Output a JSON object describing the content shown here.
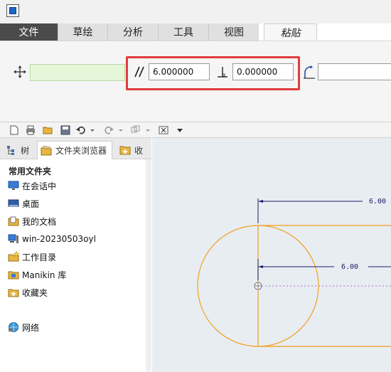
{
  "tabs": [
    {
      "label": "文件"
    },
    {
      "label": "草绘"
    },
    {
      "label": "分析"
    },
    {
      "label": "工具"
    },
    {
      "label": "视图"
    },
    {
      "label": "粘贴"
    }
  ],
  "dashboard": {
    "parallel_value": "6.000000",
    "perpendicular_value": "0.000000",
    "angle_value": ""
  },
  "navigator": {
    "tabs": [
      {
        "label": "树"
      },
      {
        "label": "文件夹浏览器"
      },
      {
        "label": "收"
      }
    ],
    "section_title": "常用文件夹",
    "items": [
      {
        "label": "在会话中",
        "icon": "monitor-icon"
      },
      {
        "label": "桌面",
        "icon": "desktop-icon"
      },
      {
        "label": "我的文档",
        "icon": "documents-icon"
      },
      {
        "label": "win-20230503oyl",
        "icon": "computer-icon"
      },
      {
        "label": "工作目录",
        "icon": "working-folder-icon"
      },
      {
        "label": "Manikin 库",
        "icon": "library-icon"
      },
      {
        "label": "收藏夹",
        "icon": "favorites-icon"
      },
      {
        "label": "网络",
        "icon": "network-icon"
      }
    ]
  },
  "sketch": {
    "dimension_top": "6.00",
    "dimension_center": "6.00",
    "sketch_color": "#f0a020",
    "dimension_color": "#1a1a66"
  },
  "colors": {
    "file_tab": "#4b4b4b",
    "highlight": "#e03c3c",
    "graphics_bg": "#e8edf2"
  }
}
